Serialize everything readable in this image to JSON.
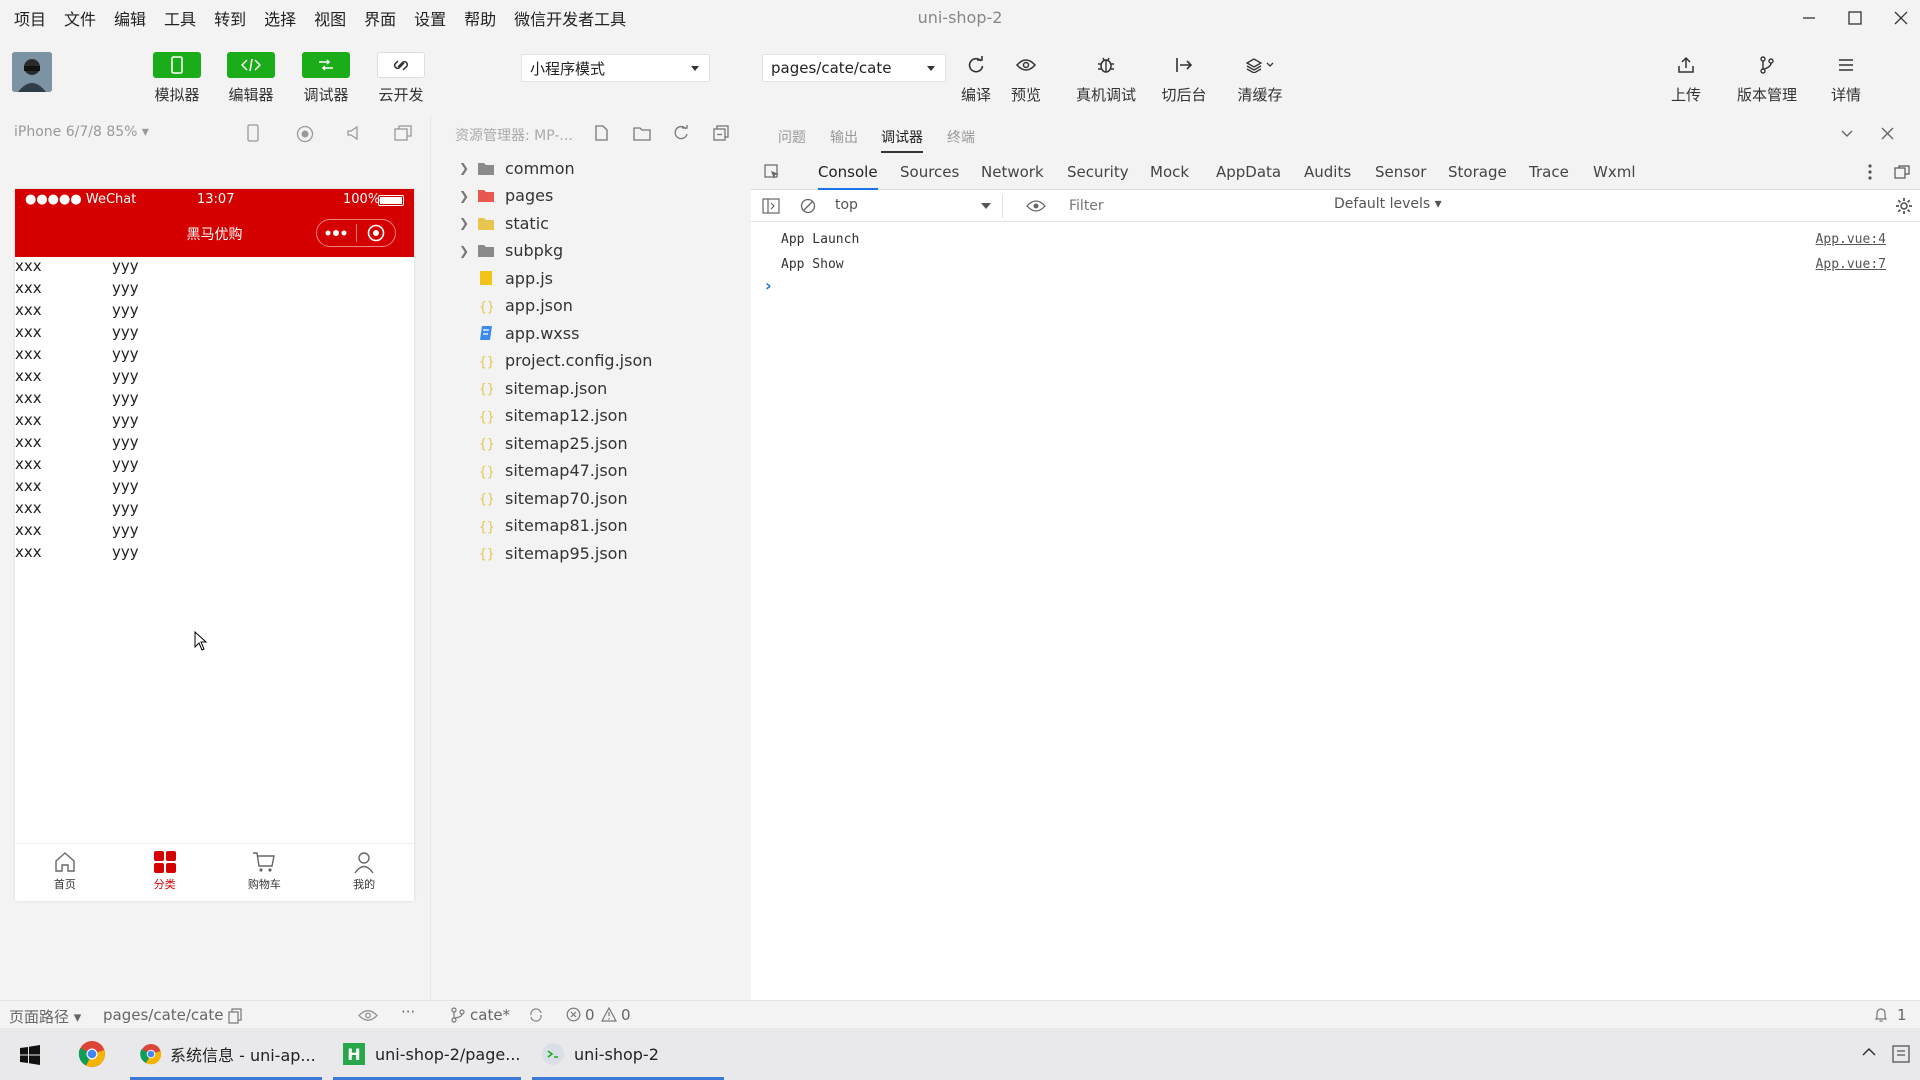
{
  "window": {
    "title": "uni-shop-2",
    "menu": [
      "项目",
      "文件",
      "编辑",
      "工具",
      "转到",
      "选择",
      "视图",
      "界面",
      "设置",
      "帮助",
      "微信开发者工具"
    ]
  },
  "toolbar": {
    "left_buttons": [
      {
        "label": "模拟器",
        "icon": "phone-icon"
      },
      {
        "label": "编辑器",
        "icon": "code-icon"
      },
      {
        "label": "调试器",
        "icon": "debug-icon"
      },
      {
        "label": "云开发",
        "icon": "cloud-icon"
      }
    ],
    "mode_select": "小程序模式",
    "page_select": "pages/cate/cate",
    "action_buttons": [
      {
        "label": "编译",
        "icon": "refresh-icon"
      },
      {
        "label": "预览",
        "icon": "eye-icon"
      },
      {
        "label": "真机调试",
        "icon": "bug-icon"
      },
      {
        "label": "切后台",
        "icon": "switch-icon"
      },
      {
        "label": "清缓存",
        "icon": "layers-icon"
      }
    ],
    "right_buttons": [
      {
        "label": "上传",
        "icon": "upload-icon"
      },
      {
        "label": "版本管理",
        "icon": "branch-icon"
      },
      {
        "label": "详情",
        "icon": "menu-icon"
      }
    ]
  },
  "simulator": {
    "device": "iPhone 6/7/8 85%",
    "status_carrier": "●●●●● WeChat",
    "status_time": "13:07",
    "status_battery": "100%",
    "nav_title": "黑马优购",
    "rows": [
      [
        "xxx",
        "yyy"
      ],
      [
        "xxx",
        "yyy"
      ],
      [
        "xxx",
        "yyy"
      ],
      [
        "xxx",
        "yyy"
      ],
      [
        "xxx",
        "yyy"
      ],
      [
        "xxx",
        "yyy"
      ],
      [
        "xxx",
        "yyy"
      ],
      [
        "xxx",
        "yyy"
      ],
      [
        "xxx",
        "yyy"
      ],
      [
        "xxx",
        "yyy"
      ],
      [
        "xxx",
        "yyy"
      ],
      [
        "xxx",
        "yyy"
      ],
      [
        "xxx",
        "yyy"
      ],
      [
        "xxx",
        "yyy"
      ]
    ],
    "tabs": [
      {
        "label": "首页",
        "icon": "home-icon",
        "active": false
      },
      {
        "label": "分类",
        "icon": "category-icon",
        "active": true
      },
      {
        "label": "购物车",
        "icon": "cart-icon",
        "active": false
      },
      {
        "label": "我的",
        "icon": "user-icon",
        "active": false
      }
    ]
  },
  "explorer": {
    "header": "资源管理器: MP-...",
    "items": [
      {
        "name": "common",
        "type": "folder",
        "color": "#8a8a8a"
      },
      {
        "name": "pages",
        "type": "folder",
        "color": "#e8584f"
      },
      {
        "name": "static",
        "type": "folder",
        "color": "#e8c54f"
      },
      {
        "name": "subpkg",
        "type": "folder",
        "color": "#8a8a8a"
      },
      {
        "name": "app.js",
        "type": "js",
        "color": "#f0c419"
      },
      {
        "name": "app.json",
        "type": "json",
        "color": "#e8c54f"
      },
      {
        "name": "app.wxss",
        "type": "wxss",
        "color": "#3c8be8"
      },
      {
        "name": "project.config.json",
        "type": "json",
        "color": "#e8c54f"
      },
      {
        "name": "sitemap.json",
        "type": "json",
        "color": "#e8c54f"
      },
      {
        "name": "sitemap12.json",
        "type": "json",
        "color": "#e8c54f"
      },
      {
        "name": "sitemap25.json",
        "type": "json",
        "color": "#e8c54f"
      },
      {
        "name": "sitemap47.json",
        "type": "json",
        "color": "#e8c54f"
      },
      {
        "name": "sitemap70.json",
        "type": "json",
        "color": "#e8c54f"
      },
      {
        "name": "sitemap81.json",
        "type": "json",
        "color": "#e8c54f"
      },
      {
        "name": "sitemap95.json",
        "type": "json",
        "color": "#e8c54f"
      }
    ]
  },
  "devtools": {
    "top_tabs": [
      "问题",
      "输出",
      "调试器",
      "终端"
    ],
    "tabs": [
      "Console",
      "Sources",
      "Network",
      "Security",
      "Mock",
      "AppData",
      "Audits",
      "Sensor",
      "Storage",
      "Trace",
      "Wxml"
    ],
    "context": "top",
    "filter_placeholder": "Filter",
    "levels": "Default levels",
    "console": [
      {
        "text": "App Launch",
        "source": "App.vue:4"
      },
      {
        "text": "App Show",
        "source": "App.vue:7"
      }
    ],
    "prompt": "›"
  },
  "statusbar": {
    "page_path_label": "页面路径",
    "page_path": "pages/cate/cate",
    "branch": "cate*",
    "errors": "0",
    "warnings": "0",
    "notifications": "1"
  },
  "taskbar": {
    "tasks": [
      "系统信息 - uni-ap...",
      "uni-shop-2/page...",
      "uni-shop-2"
    ]
  },
  "colors": {
    "accent_green": "#1aad19",
    "nav_red": "#d50000",
    "devtools_blue": "#1a73e8"
  }
}
